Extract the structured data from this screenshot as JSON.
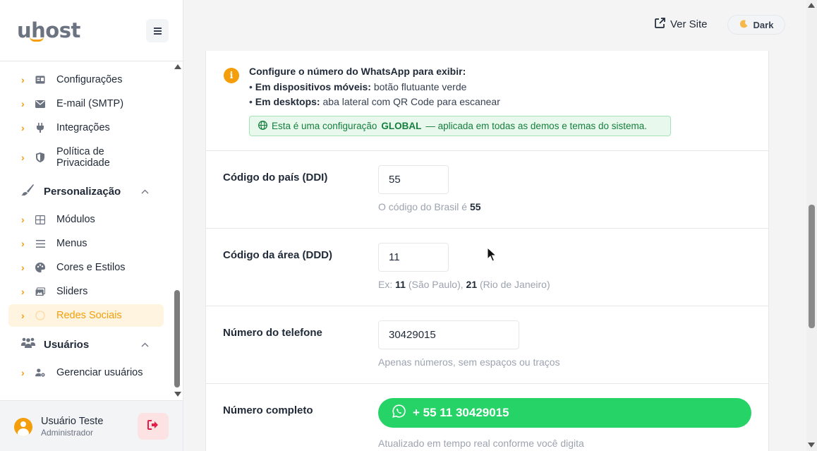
{
  "brand": {
    "logo": "uhost"
  },
  "sidebar": {
    "items_top": [
      {
        "label": "Configurações",
        "icon": "id-card-icon"
      },
      {
        "label": "E-mail (SMTP)",
        "icon": "envelope-icon"
      },
      {
        "label": "Integrações",
        "icon": "plug-icon"
      },
      {
        "label": "Política de Privacidade",
        "line1": "Política de",
        "line2": "Privacidade",
        "icon": "shield-icon"
      }
    ],
    "section_personalizacao": "Personalização",
    "items_personalizacao": [
      {
        "label": "Módulos",
        "icon": "grid-icon"
      },
      {
        "label": "Menus",
        "icon": "list-icon"
      },
      {
        "label": "Cores e Estilos",
        "icon": "palette-icon"
      },
      {
        "label": "Sliders",
        "icon": "images-icon"
      },
      {
        "label": "Redes Sociais",
        "icon": "whatsapp-icon",
        "active": true
      }
    ],
    "section_usuarios": "Usuários",
    "items_usuarios": [
      {
        "label": "Gerenciar usuários",
        "icon": "user-gear-icon"
      }
    ]
  },
  "user": {
    "name": "Usuário Teste",
    "role": "Administrador"
  },
  "header": {
    "ver_site": "Ver Site",
    "dark": "Dark"
  },
  "info": {
    "title": "Configure o número do WhatsApp para exibir:",
    "mobile_bold": "Em dispositivos móveis:",
    "mobile_text": "botão flutuante verde",
    "desktop_bold": "Em desktops:",
    "desktop_text": "aba lateral com QR Code para escanear",
    "global_prefix": "Esta é uma configuração",
    "global_bold": "GLOBAL",
    "global_suffix": "— aplicada em todas as demos e temas do sistema."
  },
  "fields": {
    "ddi": {
      "label": "Código do país (DDI)",
      "value": "55",
      "help_prefix": "O código do Brasil é",
      "help_bold": "55"
    },
    "ddd": {
      "label": "Código da área (DDD)",
      "value": "11",
      "help_ex": "Ex:",
      "help_b1": "11",
      "help_t1": "(São Paulo),",
      "help_b2": "21",
      "help_t2": "(Rio de Janeiro)"
    },
    "phone": {
      "label": "Número do telefone",
      "value": "30429015",
      "help": "Apenas números, sem espaços ou traços"
    },
    "full": {
      "label": "Número completo",
      "value": "+ 55 11 30429015",
      "help": "Atualizado em tempo real conforme você digita"
    }
  },
  "colors": {
    "accent": "#f59e0b",
    "whatsapp": "#25d366",
    "success_bg": "#e8f8ed",
    "success_text": "#15803d"
  }
}
